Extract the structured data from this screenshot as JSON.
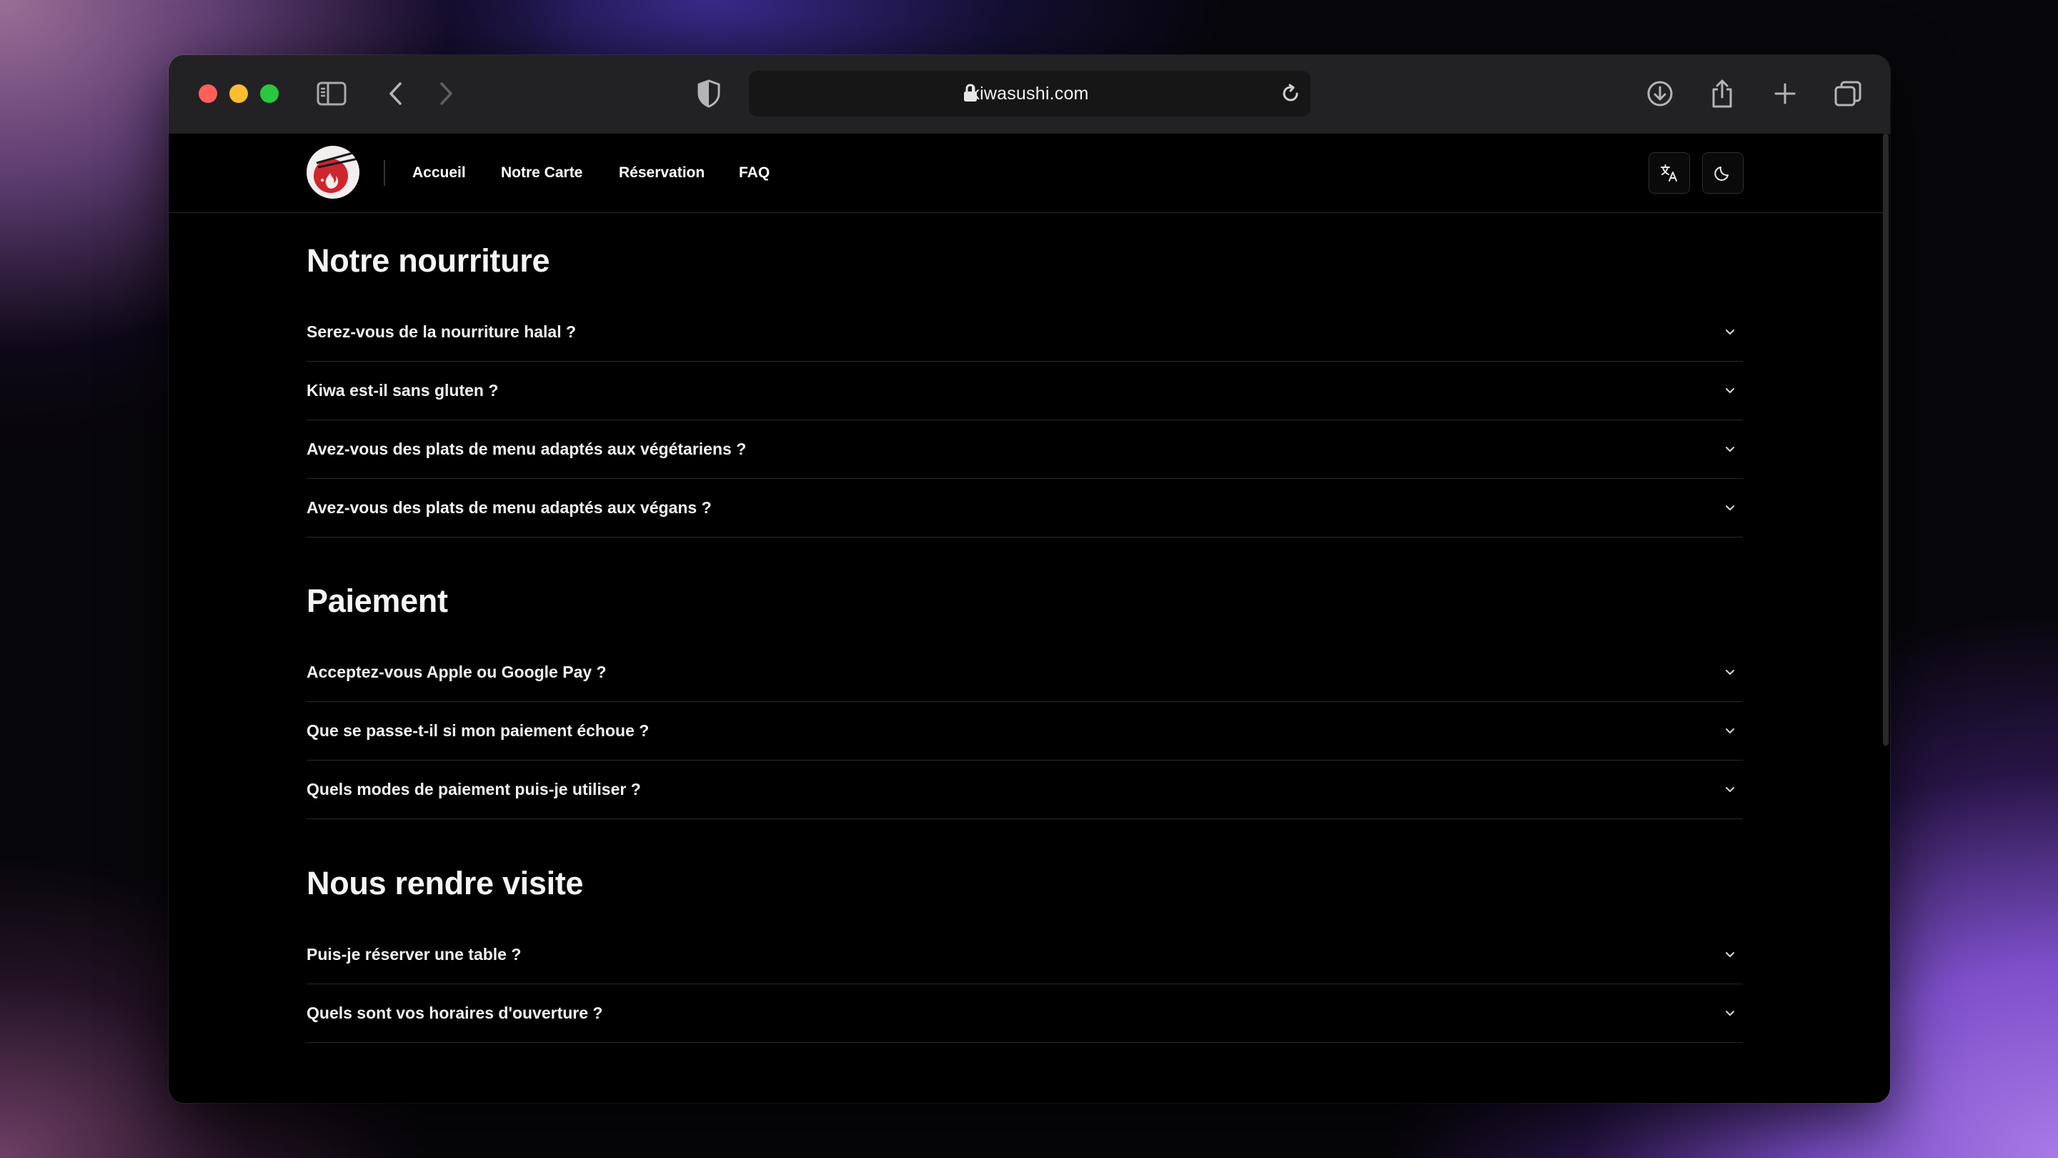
{
  "browser": {
    "url": "kiwasushi.com"
  },
  "nav": {
    "items": [
      "Accueil",
      "Notre Carte",
      "Réservation",
      "FAQ"
    ]
  },
  "sections": [
    {
      "title": "Notre nourriture",
      "questions": [
        "Serez-vous de la nourriture halal ?",
        "Kiwa est-il sans gluten ?",
        "Avez-vous des plats de menu adaptés aux végétariens ?",
        "Avez-vous des plats de menu adaptés aux végans ?"
      ]
    },
    {
      "title": "Paiement",
      "questions": [
        "Acceptez-vous Apple ou Google Pay ?",
        "Que se passe-t-il si mon paiement échoue ?",
        "Quels modes de paiement puis-je utiliser ?"
      ]
    },
    {
      "title": "Nous rendre visite",
      "questions": [
        "Puis-je réserver une table ?",
        "Quels sont vos horaires d'ouverture ?"
      ]
    }
  ],
  "colors": {
    "traffic_close": "#ff5f57",
    "traffic_minimize": "#febc2e",
    "traffic_maximize": "#28c840",
    "page_background": "#000000",
    "logo_accent": "#d0252f"
  }
}
